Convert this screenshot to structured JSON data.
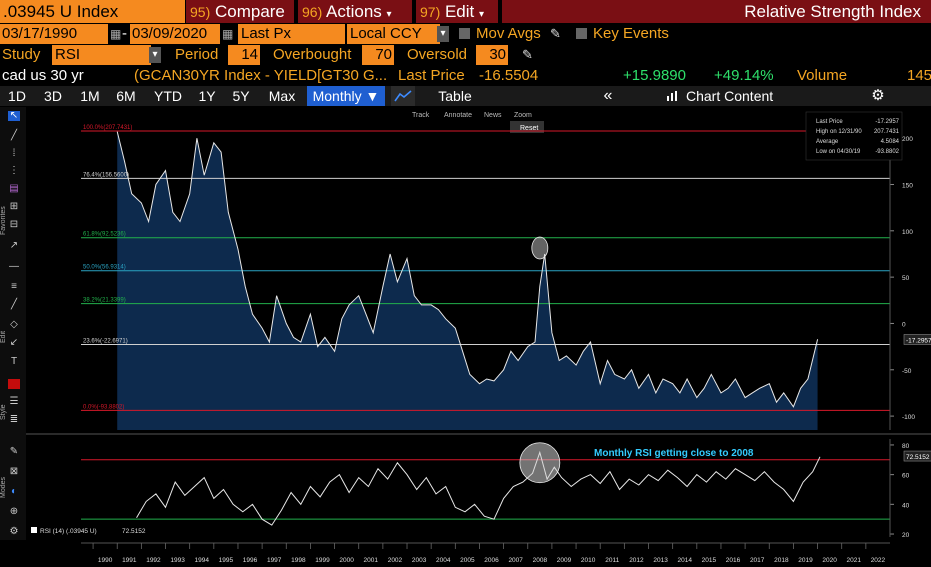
{
  "toolbar1": {
    "ticker": ".03945 U Index",
    "compare_num": "95)",
    "compare": "Compare",
    "actions_num": "96)",
    "actions": "Actions",
    "edit_num": "97)",
    "edit": "Edit",
    "title": "Relative Strength Index"
  },
  "toolbar2": {
    "start_date": "03/17/1990",
    "end_date": "03/09/2020",
    "price_field": "Last Px",
    "currency": "Local CCY",
    "mov_avgs": "Mov Avgs",
    "key_events": "Key Events"
  },
  "toolbar3": {
    "study_label": "Study",
    "study_value": "RSI",
    "period_label": "Period",
    "period_value": "14",
    "overbought_label": "Overbought",
    "overbought_value": "70",
    "oversold_label": "Oversold",
    "oversold_value": "30"
  },
  "toolbar4": {
    "name": "cad us 30 yr",
    "description": "(GCAN30YR Index - YIELD[GT30 G...",
    "last_price_label": "Last Price",
    "last_price": "-16.5504",
    "change": "+15.9890",
    "change_pct": "+49.14%",
    "volume_label": "Volume",
    "volume": "145"
  },
  "toolbar5": {
    "periods": [
      "1D",
      "3D",
      "1M",
      "6M",
      "YTD",
      "1Y",
      "5Y",
      "Max"
    ],
    "frequency": "Monthly ▼",
    "table": "Table",
    "collapse": "«",
    "chart_content": "Chart Content"
  },
  "chart_tools": {
    "track": "Track",
    "annotate": "Annotate",
    "news": "News",
    "zoom": "Zoom",
    "reset": "Reset"
  },
  "sidebar_labels": {
    "favorites": "Favorites",
    "edit": "Edit",
    "style": "Style",
    "modes": "Modes"
  },
  "colors": {
    "orange": "#f58a1f",
    "dark_red": "#7a0f14",
    "fib_red": "#d6182a",
    "fib_green": "#22b14c",
    "fib_cyan": "#2aa3c2",
    "area_fill": "#0d2a4d",
    "annotation": "#33ccff"
  },
  "chart_data": [
    {
      "type": "area",
      "y_ticks": [
        "200",
        "150",
        "100",
        "50",
        "0",
        "-50",
        "-100"
      ],
      "ylim": [
        -115,
        225
      ],
      "x_ticks": [
        "1990",
        "1991",
        "1992",
        "1993",
        "1994",
        "1995",
        "1996",
        "1997",
        "1998",
        "1999",
        "2000",
        "2001",
        "2002",
        "2003",
        "2004",
        "2005",
        "2006",
        "2007",
        "2008",
        "2009",
        "2010",
        "2011",
        "2012",
        "2013",
        "2014",
        "2015",
        "2016",
        "2017",
        "2018",
        "2019",
        "2020",
        "2021",
        "2022"
      ],
      "xlim": [
        1989.5,
        2023.0
      ],
      "current_value_label": "-17.2957",
      "legend": [
        {
          "label": "Last Price",
          "value": "-17.2957"
        },
        {
          "label": "High on 12/31/90",
          "value": "207.7431"
        },
        {
          "label": "Average",
          "value": "4.5084"
        },
        {
          "label": "Low on 04/30/19",
          "value": "-93.8802"
        }
      ],
      "fib_levels": [
        {
          "label": "100.0%(207.7431)",
          "value": 207.7431,
          "color": "#d6182a"
        },
        {
          "label": "76.4%(156.5600)",
          "value": 156.56,
          "color": "#d0d0d0"
        },
        {
          "label": "61.8%(92.5236)",
          "value": 92.5236,
          "color": "#22b14c"
        },
        {
          "label": "50.0%(56.9314)",
          "value": 56.9314,
          "color": "#2aa3c2"
        },
        {
          "label": "38.2%(21.3399)",
          "value": 21.3399,
          "color": "#22b14c"
        },
        {
          "label": "23.6%(-22.6971)",
          "value": -22.6971,
          "color": "#d0d0d0"
        },
        {
          "label": "0.0%(-93.8802)",
          "value": -93.8802,
          "color": "#d6182a"
        }
      ],
      "x": [
        1991.0,
        1991.3,
        1991.6,
        1992.0,
        1992.3,
        1992.6,
        1993.0,
        1993.3,
        1993.6,
        1994.0,
        1994.3,
        1994.6,
        1995.0,
        1995.3,
        1995.6,
        1996.0,
        1996.3,
        1996.6,
        1997.0,
        1997.3,
        1997.6,
        1998.0,
        1998.3,
        1998.6,
        1999.0,
        1999.3,
        1999.6,
        2000.0,
        2000.3,
        2000.6,
        2001.0,
        2001.3,
        2001.6,
        2002.0,
        2002.3,
        2002.6,
        2003.0,
        2003.3,
        2003.6,
        2004.0,
        2004.3,
        2004.6,
        2005.0,
        2005.3,
        2005.6,
        2006.0,
        2006.3,
        2006.6,
        2007.0,
        2007.3,
        2007.6,
        2008.0,
        2008.3,
        2008.5,
        2008.7,
        2009.0,
        2009.3,
        2009.6,
        2010.0,
        2010.3,
        2010.6,
        2011.0,
        2011.3,
        2011.6,
        2012.0,
        2012.3,
        2012.6,
        2013.0,
        2013.3,
        2013.6,
        2014.0,
        2014.3,
        2014.6,
        2015.0,
        2015.3,
        2015.6,
        2016.0,
        2016.3,
        2016.6,
        2017.0,
        2017.3,
        2017.6,
        2018.0,
        2018.3,
        2018.6,
        2019.0,
        2019.3,
        2019.6,
        2020.0
      ],
      "values": [
        207,
        175,
        140,
        130,
        110,
        150,
        165,
        120,
        110,
        140,
        200,
        160,
        195,
        185,
        120,
        80,
        40,
        10,
        -5,
        -20,
        30,
        0,
        -15,
        -20,
        10,
        -25,
        -15,
        -30,
        5,
        20,
        30,
        10,
        -10,
        40,
        75,
        45,
        70,
        30,
        20,
        20,
        15,
        5,
        -5,
        -30,
        -55,
        -65,
        -60,
        -62,
        -50,
        -30,
        -40,
        -25,
        -20,
        40,
        75,
        -10,
        -40,
        -35,
        -45,
        -30,
        -20,
        -65,
        -40,
        -55,
        -60,
        -50,
        -70,
        -55,
        -75,
        -60,
        -65,
        -75,
        -60,
        -80,
        -70,
        -55,
        -75,
        -70,
        -60,
        -80,
        -75,
        -70,
        -65,
        -85,
        -75,
        -90,
        -70,
        -60,
        -17
      ]
    },
    {
      "type": "line",
      "series_label": "RSI (14) (.03945 U)",
      "last_value": "72.5152",
      "y_ticks": [
        "80",
        "60",
        "40",
        "20"
      ],
      "ylim": [
        18,
        84
      ],
      "xlim": [
        1989.5,
        2023.0
      ],
      "overbought": 70,
      "oversold": 30,
      "annotation": "Monthly RSI getting close to 2008",
      "x": [
        1991.8,
        1992.2,
        1992.6,
        1993.0,
        1993.4,
        1993.8,
        1994.2,
        1994.6,
        1995.0,
        1995.4,
        1995.8,
        1996.2,
        1996.6,
        1997.0,
        1997.4,
        1997.8,
        1998.2,
        1998.6,
        1999.0,
        1999.4,
        1999.8,
        2000.2,
        2000.6,
        2001.0,
        2001.4,
        2001.8,
        2002.2,
        2002.6,
        2003.0,
        2003.4,
        2003.8,
        2004.2,
        2004.6,
        2005.0,
        2005.4,
        2005.8,
        2006.2,
        2006.6,
        2007.0,
        2007.4,
        2007.8,
        2008.2,
        2008.5,
        2008.8,
        2009.1,
        2009.4,
        2009.8,
        2010.2,
        2010.6,
        2011.0,
        2011.4,
        2011.8,
        2012.2,
        2012.6,
        2013.0,
        2013.4,
        2013.8,
        2014.2,
        2014.6,
        2015.0,
        2015.4,
        2015.8,
        2016.2,
        2016.6,
        2017.0,
        2017.4,
        2017.8,
        2018.2,
        2018.6,
        2019.0,
        2019.4,
        2019.8,
        2020.1
      ],
      "values": [
        31,
        42,
        47,
        38,
        55,
        46,
        52,
        58,
        44,
        50,
        40,
        35,
        40,
        30,
        26,
        36,
        48,
        40,
        52,
        45,
        55,
        60,
        48,
        58,
        52,
        64,
        57,
        68,
        60,
        50,
        58,
        47,
        52,
        38,
        35,
        40,
        32,
        30,
        44,
        52,
        55,
        61,
        75,
        57,
        65,
        58,
        52,
        57,
        60,
        54,
        62,
        50,
        57,
        53,
        60,
        56,
        63,
        58,
        52,
        60,
        55,
        62,
        57,
        64,
        60,
        56,
        62,
        55,
        50,
        42,
        55,
        62,
        72
      ]
    }
  ]
}
